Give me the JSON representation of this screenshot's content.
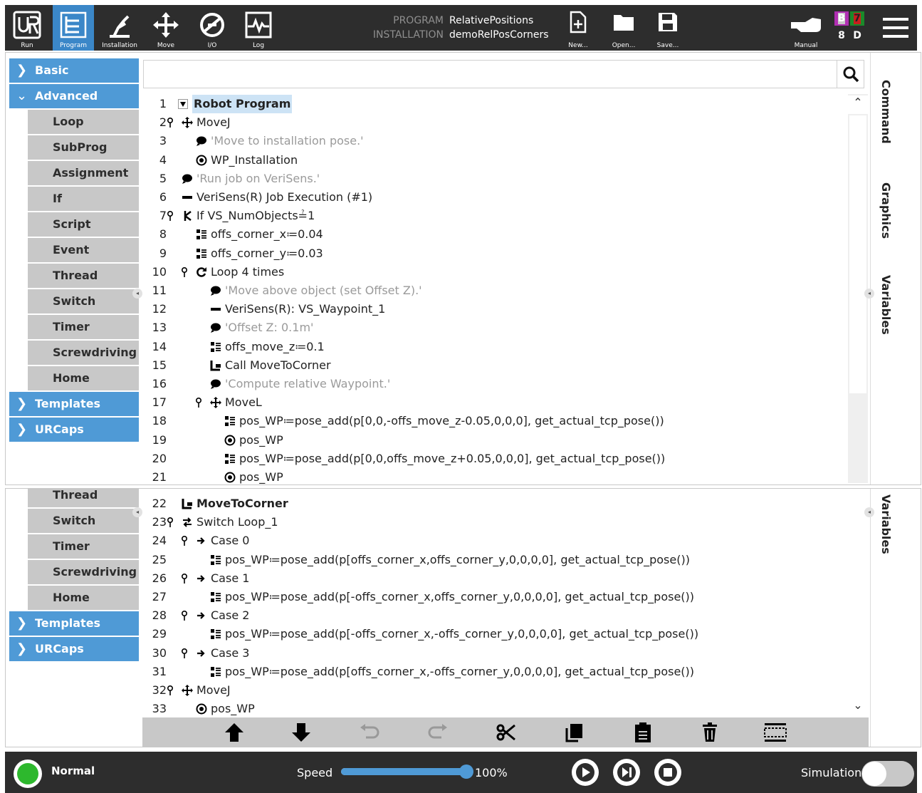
{
  "toolbar": {
    "logo": "UR",
    "buttons": [
      {
        "label": "Run",
        "icon": "ur-logo-icon"
      },
      {
        "label": "Program",
        "icon": "program-icon"
      },
      {
        "label": "Installation",
        "icon": "installation-icon"
      },
      {
        "label": "Move",
        "icon": "move-icon"
      },
      {
        "label": "I/O",
        "icon": "io-icon"
      },
      {
        "label": "Log",
        "icon": "log-icon"
      }
    ],
    "program_key": "PROGRAM",
    "program_value": "RelativePositions",
    "installation_key": "INSTALLATION",
    "installation_value": "demoRelPosCorners",
    "file_buttons": [
      {
        "label": "New...",
        "icon": "new-file-icon"
      },
      {
        "label": "Open...",
        "icon": "open-folder-icon"
      },
      {
        "label": "Save...",
        "icon": "save-icon"
      }
    ],
    "mode_label": "Manual",
    "badges": [
      {
        "text": "B",
        "color": "#b02fb2"
      },
      {
        "text": "7",
        "color": "#c8c8c8"
      },
      {
        "text": "8",
        "color": "#1a8a2a"
      },
      {
        "text": "D",
        "color": "#c81e1e"
      }
    ]
  },
  "sidebar_top": {
    "categories": [
      {
        "label": "Basic",
        "state": "collapsed"
      },
      {
        "label": "Advanced",
        "state": "expanded"
      }
    ],
    "advanced_items": [
      "Loop",
      "SubProg",
      "Assignment",
      "If",
      "Script",
      "Event",
      "Thread",
      "Switch",
      "Timer",
      "Screwdriving",
      "Home"
    ],
    "bottom_categories": [
      "Templates",
      "URCaps"
    ]
  },
  "sidebar_bottom": {
    "items": [
      "Thread",
      "Switch",
      "Timer",
      "Screwdriving",
      "Home"
    ],
    "categories": [
      "Templates",
      "URCaps"
    ]
  },
  "search": {
    "placeholder": ""
  },
  "program_top": [
    {
      "n": "1",
      "text": "Robot Program",
      "icon": "collapse-triangle-icon",
      "level": 0
    },
    {
      "n": "2",
      "text": "MoveJ",
      "icon": "move-icon",
      "level": 0
    },
    {
      "n": "3",
      "text": "'Move to installation pose.'",
      "icon": "comment-icon",
      "level": 1
    },
    {
      "n": "4",
      "text": "WP_Installation",
      "icon": "waypoint-icon",
      "level": 1
    },
    {
      "n": "5",
      "text": "'Run job on VeriSens.'",
      "icon": "comment-icon",
      "level": 0
    },
    {
      "n": "6",
      "text": "VeriSens(R) Job Execution (#1)",
      "icon": "urcap-icon",
      "level": 0
    },
    {
      "n": "7",
      "text": "If VS_NumObjects≟1",
      "icon": "if-icon",
      "level": 0
    },
    {
      "n": "8",
      "text": "offs_corner_x≔0.04",
      "icon": "assignment-icon",
      "level": 1
    },
    {
      "n": "9",
      "text": "offs_corner_y≔0.03",
      "icon": "assignment-icon",
      "level": 1
    },
    {
      "n": "10",
      "text": "Loop 4 times",
      "icon": "loop-icon",
      "level": 1
    },
    {
      "n": "11",
      "text": "'Move above object (set Offset Z).'",
      "icon": "comment-icon",
      "level": 2
    },
    {
      "n": "12",
      "text": "VeriSens(R): VS_Waypoint_1",
      "icon": "urcap-icon",
      "level": 2
    },
    {
      "n": "13",
      "text": "'Offset Z: 0.1m'",
      "icon": "comment-icon",
      "level": 2
    },
    {
      "n": "14",
      "text": "offs_move_z≔0.1",
      "icon": "assignment-icon",
      "level": 2
    },
    {
      "n": "15",
      "text": "Call MoveToCorner",
      "icon": "subprog-call-icon",
      "level": 2
    },
    {
      "n": "16",
      "text": "'Compute relative Waypoint.'",
      "icon": "comment-icon",
      "level": 2
    },
    {
      "n": "17",
      "text": "MoveL",
      "icon": "move-icon",
      "level": 2
    },
    {
      "n": "18",
      "text": "pos_WP≔pose_add(p[0,0,-offs_move_z-0.05,0,0,0], get_actual_tcp_pose())",
      "icon": "assignment-icon",
      "level": 3
    },
    {
      "n": "19",
      "text": "pos_WP",
      "icon": "waypoint-icon",
      "level": 3
    },
    {
      "n": "20",
      "text": "pos_WP≔pose_add(p[0,0,offs_move_z+0.05,0,0,0], get_actual_tcp_pose())",
      "icon": "assignment-icon",
      "level": 3
    },
    {
      "n": "21",
      "text": "pos_WP",
      "icon": "waypoint-icon",
      "level": 3
    }
  ],
  "program_bottom": [
    {
      "n": "22",
      "text": "MoveToCorner",
      "icon": "subprog-call-icon",
      "level": 0
    },
    {
      "n": "23",
      "text": "Switch Loop_1",
      "icon": "switch-icon",
      "level": 0
    },
    {
      "n": "24",
      "text": "Case 0",
      "icon": "case-arrow-icon",
      "level": 1
    },
    {
      "n": "25",
      "text": "pos_WP≔pose_add(p[offs_corner_x,offs_corner_y,0,0,0,0], get_actual_tcp_pose())",
      "icon": "assignment-icon",
      "level": 2
    },
    {
      "n": "26",
      "text": "Case 1",
      "icon": "case-arrow-icon",
      "level": 1
    },
    {
      "n": "27",
      "text": "pos_WP≔pose_add(p[-offs_corner_x,offs_corner_y,0,0,0,0], get_actual_tcp_pose())",
      "icon": "assignment-icon",
      "level": 2
    },
    {
      "n": "28",
      "text": "Case 2",
      "icon": "case-arrow-icon",
      "level": 1
    },
    {
      "n": "29",
      "text": "pos_WP≔pose_add(p[-offs_corner_x,-offs_corner_y,0,0,0,0], get_actual_tcp_pose())",
      "icon": "assignment-icon",
      "level": 2
    },
    {
      "n": "30",
      "text": "Case 3",
      "icon": "case-arrow-icon",
      "level": 1
    },
    {
      "n": "31",
      "text": "pos_WP≔pose_add(p[offs_corner_x,-offs_corner_y,0,0,0,0], get_actual_tcp_pose())",
      "icon": "assignment-icon",
      "level": 2
    },
    {
      "n": "32",
      "text": "MoveJ",
      "icon": "move-icon",
      "level": 0
    },
    {
      "n": "33",
      "text": "pos_WP",
      "icon": "waypoint-icon",
      "level": 1
    }
  ],
  "right_tabs_top": [
    "Command",
    "Graphics",
    "Variables"
  ],
  "right_tabs_bottom": [
    "Variables"
  ],
  "editbar": [
    "move-up-icon",
    "move-down-icon",
    "undo-icon",
    "redo-icon",
    "cut-icon",
    "copy-icon",
    "paste-icon",
    "delete-icon",
    "suppress-icon"
  ],
  "footer": {
    "status": "Normal",
    "status_color": "#2db82d",
    "speed_label": "Speed",
    "speed_value": "100%",
    "speed_fraction": 1.0,
    "simulation_label": "Simulation"
  }
}
